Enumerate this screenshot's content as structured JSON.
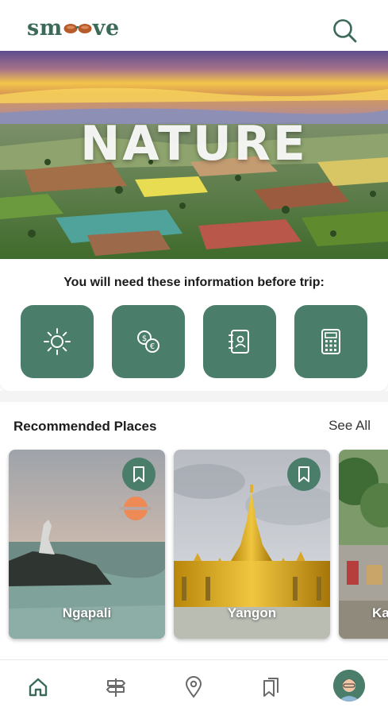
{
  "app": {
    "logo_text_left": "sm",
    "logo_text_right": "ve"
  },
  "hero": {
    "title": "NATURE"
  },
  "info": {
    "title": "You will need these information before trip:",
    "tools": [
      {
        "icon": "sun-icon"
      },
      {
        "icon": "currency-exchange-icon"
      },
      {
        "icon": "contacts-book-icon"
      },
      {
        "icon": "calculator-icon"
      }
    ]
  },
  "recommended": {
    "title": "Recommended Places",
    "see_all": "See All",
    "places": [
      {
        "name": "Ngapali"
      },
      {
        "name": "Yangon"
      },
      {
        "name": "Ka"
      }
    ]
  },
  "nav": {
    "items": [
      "home-icon",
      "signpost-icon",
      "location-pin-icon",
      "bookmarks-icon"
    ],
    "active": "home-icon"
  },
  "colors": {
    "accent": "#4a7e6b",
    "logo": "#3b6b58"
  }
}
